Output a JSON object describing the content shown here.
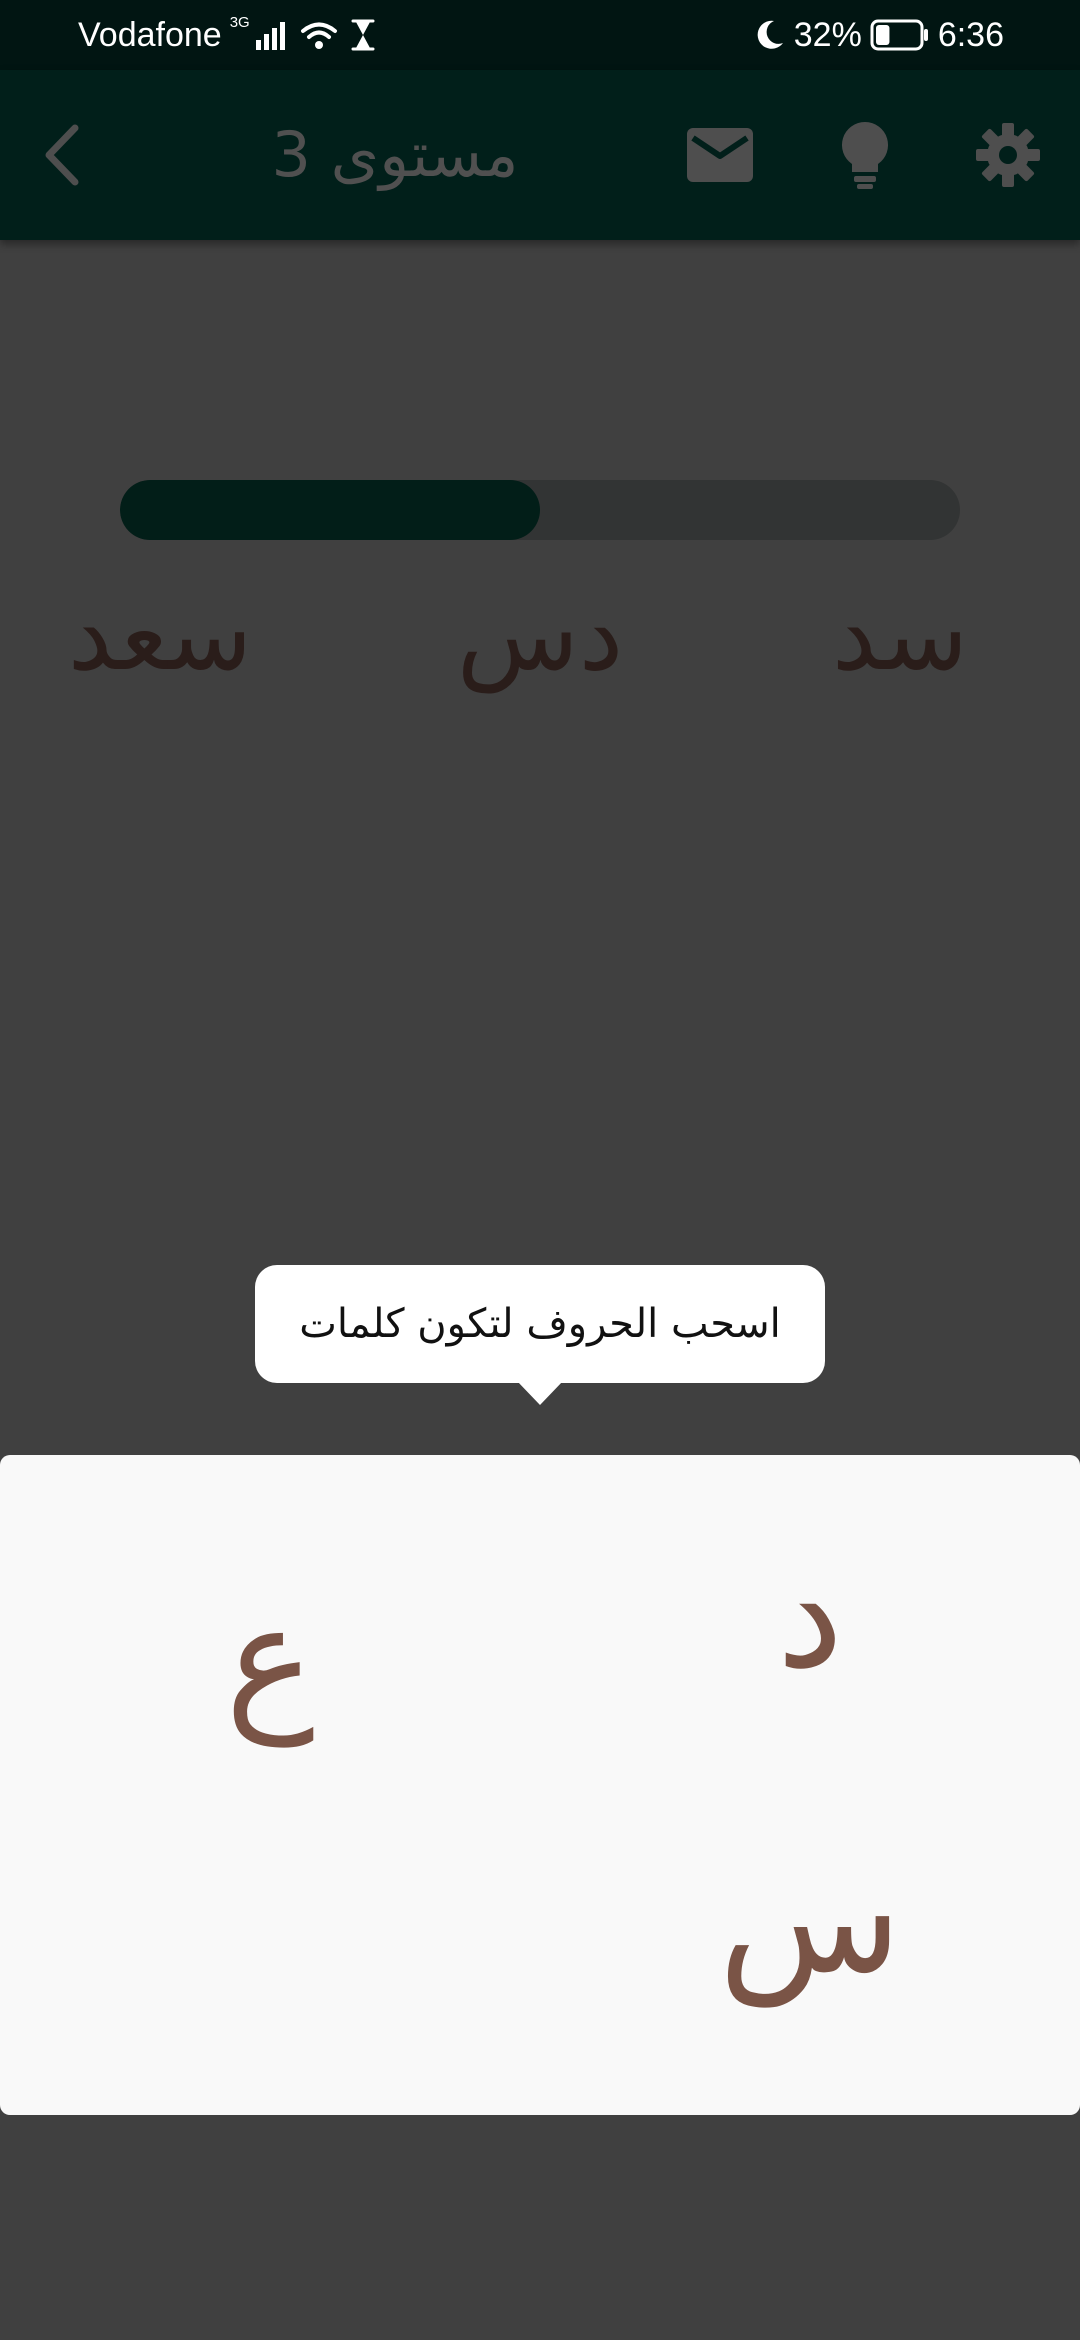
{
  "status_bar": {
    "carrier": "Vodafone",
    "network_type": "3G",
    "battery_percent": "32%",
    "battery_level": 0.32,
    "time": "6:36",
    "icons": [
      "signal-icon",
      "wifi-icon",
      "hourglass-icon",
      "moon-icon",
      "battery-icon"
    ]
  },
  "app_bar": {
    "title": "مستوى 3",
    "icons": [
      "back-icon",
      "mail-icon",
      "lightbulb-icon",
      "gear-icon"
    ]
  },
  "progress": {
    "value": 0.5
  },
  "found_words": [
    "سد",
    "دس",
    "سعد"
  ],
  "tooltip": {
    "text": "اسحب الحروف لتكون كلمات"
  },
  "letters": {
    "top_right": "د",
    "top_left": "ع",
    "bottom_right": "س"
  },
  "colors": {
    "status_bar_bg": "#011512",
    "app_bar_bg": "#011f1a",
    "overlay_bg": "#404040",
    "progress_fill": "#021e18",
    "progress_track": "#323434",
    "letter_color": "#7a5446",
    "board_bg": "#f9f9f9"
  }
}
